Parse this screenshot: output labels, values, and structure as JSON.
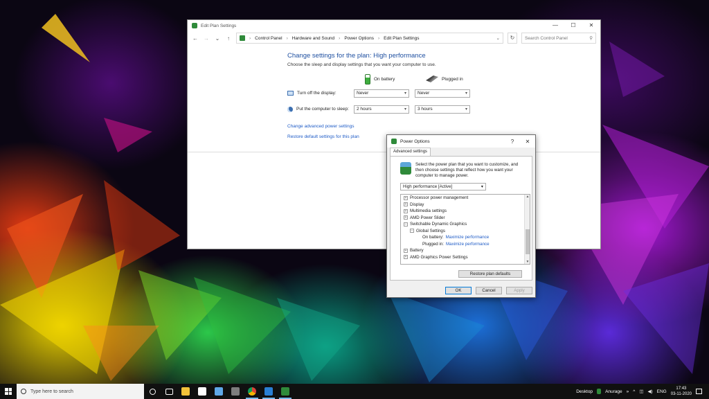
{
  "window": {
    "title": "Edit Plan Settings",
    "controls": {
      "minimize": "—",
      "maximize": "☐",
      "close": "✕"
    },
    "nav": {
      "back": "←",
      "forward": "→",
      "recent": "⌄",
      "up": "↑",
      "refresh": "↻"
    },
    "breadcrumbs": [
      "Control Panel",
      "Hardware and Sound",
      "Power Options",
      "Edit Plan Settings"
    ],
    "search_placeholder": "Search Control Panel"
  },
  "plan": {
    "heading": "Change settings for the plan: High performance",
    "subtitle": "Choose the sleep and display settings that you want your computer to use.",
    "columns": {
      "battery": "On battery",
      "plugged": "Plugged in"
    },
    "rows": [
      {
        "label": "Turn off the display:",
        "battery": "Never",
        "plugged": "Never"
      },
      {
        "label": "Put the computer to sleep:",
        "battery": "2 hours",
        "plugged": "3 hours"
      }
    ],
    "link_advanced": "Change advanced power settings",
    "link_restore": "Restore default settings for this plan"
  },
  "dialog": {
    "title": "Power Options",
    "help": "?",
    "close": "✕",
    "tab": "Advanced settings",
    "intro": "Select the power plan that you want to customize, and then choose settings that reflect how you want your computer to manage power.",
    "plan_select": "High performance [Active]",
    "tree": [
      {
        "label": "Processor power management",
        "toggle": "+"
      },
      {
        "label": "Display",
        "toggle": "+"
      },
      {
        "label": "Multimedia settings",
        "toggle": "+"
      },
      {
        "label": "AMD Power Slider",
        "toggle": "+"
      },
      {
        "label": "Switchable Dynamic Graphics",
        "toggle": "−"
      },
      {
        "label": "Global Settings",
        "toggle": "−"
      },
      {
        "label": "On battery:",
        "value": "Maximize performance"
      },
      {
        "label": "Plugged in:",
        "value": "Maximize performance"
      },
      {
        "label": "Battery",
        "toggle": "+"
      },
      {
        "label": "AMD Graphics Power Settings",
        "toggle": "+"
      }
    ],
    "restore_defaults": "Restore plan defaults",
    "ok": "OK",
    "cancel": "Cancel",
    "apply": "Apply"
  },
  "taskbar": {
    "search_placeholder": "Type here to search",
    "desktop_label": "Desktop",
    "user": "Anurage",
    "more": "»",
    "lang": "ENG",
    "time": "17:43",
    "date": "03-11-2020",
    "icons": [
      "cortana-icon",
      "task-view-icon",
      "file-explorer-icon",
      "notion-icon",
      "notepad-icon",
      "calculator-icon",
      "chrome-icon",
      "photos-icon",
      "power-options-icon"
    ],
    "colors": {
      "accent": "#76b9ed",
      "bar": "#101010"
    }
  }
}
